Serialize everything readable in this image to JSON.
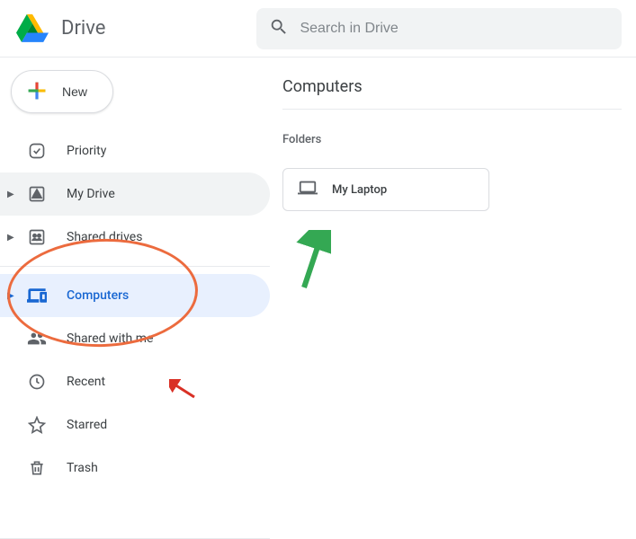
{
  "app_title": "Drive",
  "search": {
    "placeholder": "Search in Drive"
  },
  "new_button": {
    "label": "New"
  },
  "sidebar": {
    "items": [
      {
        "label": "Priority"
      },
      {
        "label": "My Drive"
      },
      {
        "label": "Shared drives"
      },
      {
        "label": "Computers"
      },
      {
        "label": "Shared with me"
      },
      {
        "label": "Recent"
      },
      {
        "label": "Starred"
      },
      {
        "label": "Trash"
      }
    ]
  },
  "main": {
    "title": "Computers",
    "folders_label": "Folders",
    "folders": [
      {
        "name": "My Laptop"
      }
    ]
  }
}
